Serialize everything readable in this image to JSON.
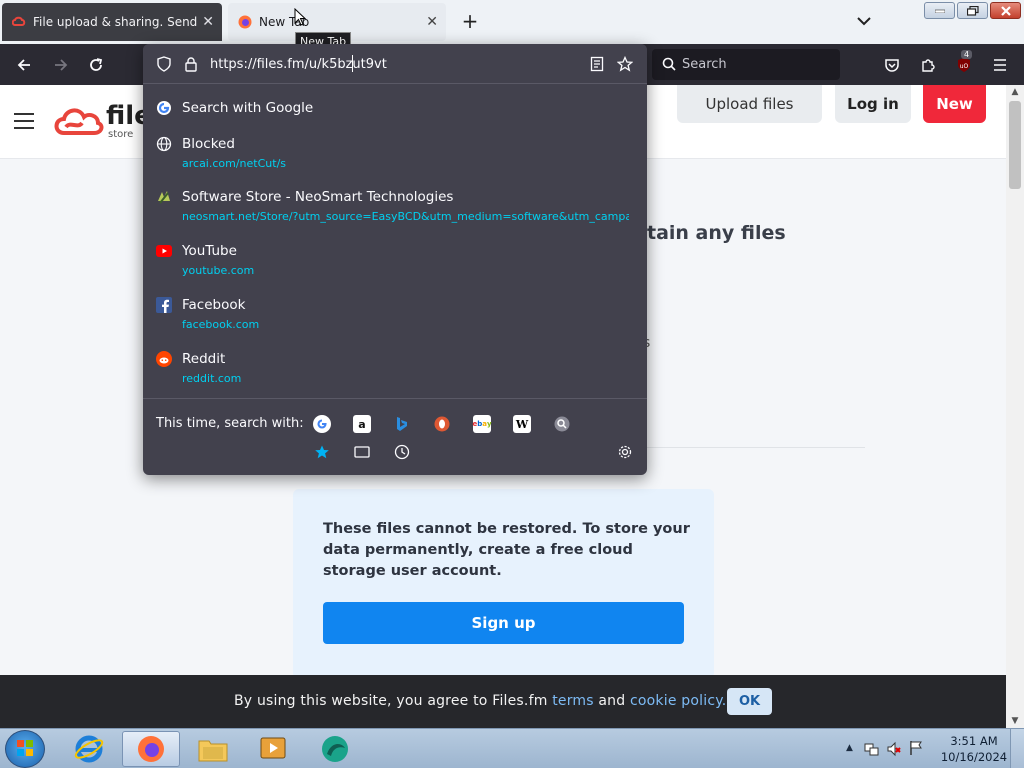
{
  "browser": {
    "tabs": [
      {
        "title": "File upload & sharing. Send large files",
        "active": false
      },
      {
        "title": "New Tab",
        "active": true
      }
    ],
    "tooltip": "New Tab",
    "url": "https://files.fm/u/k5bzut9vt",
    "search_placeholder": "Search",
    "extension_badge": "4"
  },
  "urlbar_dropdown": {
    "results": [
      {
        "title": "Search with Google",
        "url": "",
        "icon": "google-icon"
      },
      {
        "title": "Blocked",
        "url": "arcai.com/netCut/s",
        "icon": "globe-icon"
      },
      {
        "title": "Software Store - NeoSmart Technologies",
        "url": "neosmart.net/Store/?utm_source=EasyBCD&utm_medium=software&utm_campaign",
        "icon": "neosmart-icon"
      },
      {
        "title": "YouTube",
        "url": "youtube.com",
        "icon": "youtube-icon"
      },
      {
        "title": "Facebook",
        "url": "facebook.com",
        "icon": "facebook-icon"
      },
      {
        "title": "Reddit",
        "url": "reddit.com",
        "icon": "reddit-icon"
      }
    ],
    "search_with_label": "This time, search with:",
    "engines": [
      "google",
      "amazon",
      "bing",
      "duckduckgo",
      "ebay",
      "wikipedia",
      "other-search"
    ],
    "modes": [
      "bookmarks",
      "tabs",
      "history"
    ]
  },
  "site": {
    "logo_word": "file",
    "logo_sub": "store",
    "upload_label": "Upload files",
    "login_label": "Log in",
    "new_label": "New",
    "heading_fragment": "tain any files",
    "text_fragment": "s",
    "restore_notice": "These files cannot be restored. To store your data permanently, create a free cloud storage user account.",
    "signup_label": "Sign up",
    "brand_red": "#f0283a",
    "brand_blue": "#1085f0"
  },
  "cookie_banner": {
    "text_before": "By using this website, you agree to Files.fm ",
    "terms_link": "terms",
    "text_middle": " and ",
    "policy_link": "cookie policy.",
    "ok_label": "OK"
  },
  "taskbar": {
    "time": "3:51 AM",
    "date": "10/16/2024",
    "apps": [
      "internet-explorer",
      "firefox",
      "file-explorer",
      "media-player",
      "app-teal"
    ]
  }
}
